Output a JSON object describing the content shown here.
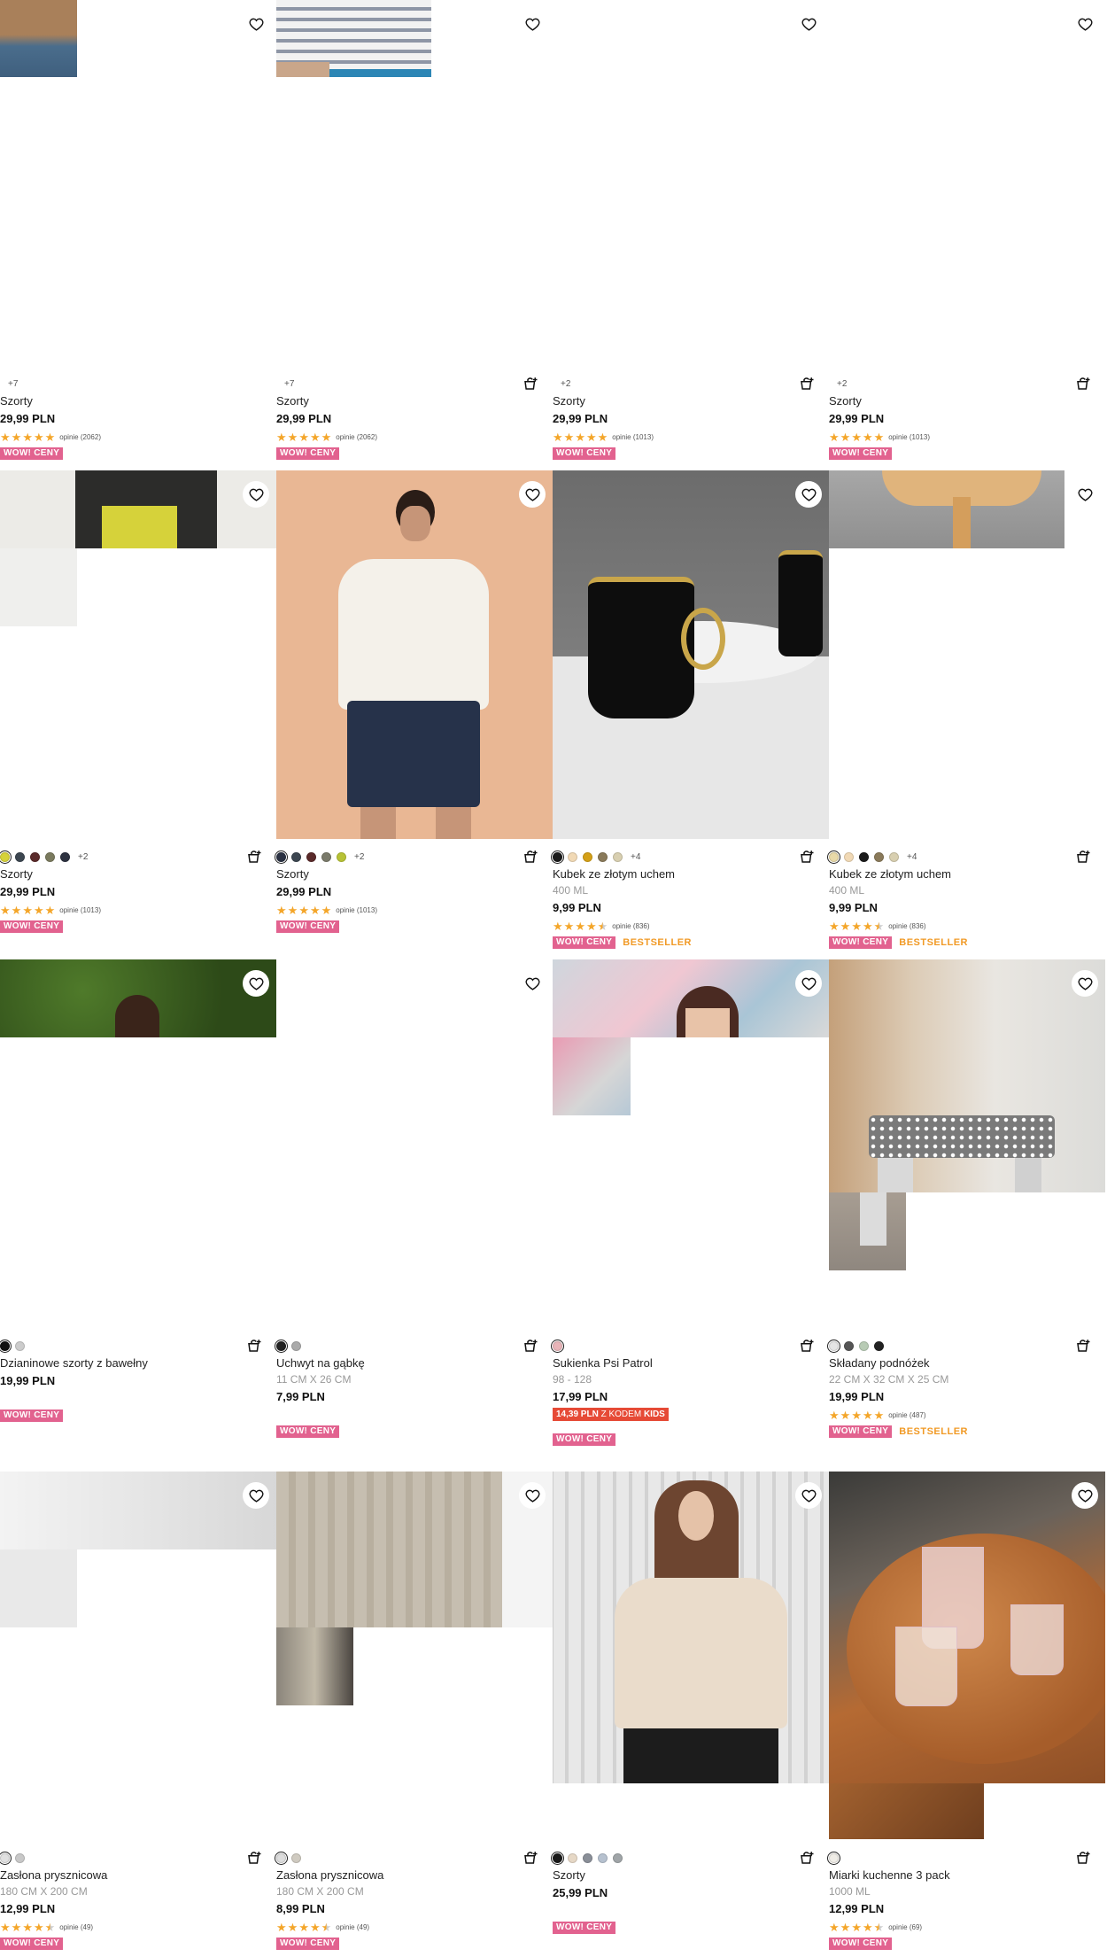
{
  "products": [
    {
      "swatches": [],
      "more": "+7",
      "name": "Szorty",
      "sub": "",
      "price": "29,99 PLN",
      "stars": 5,
      "reviews": "opinie (2062)",
      "badges": [
        "WOW! CENY"
      ],
      "cart": false
    },
    {
      "swatches": [],
      "more": "+7",
      "name": "Szorty",
      "sub": "",
      "price": "29,99 PLN",
      "stars": 5,
      "reviews": "opinie (2062)",
      "badges": [
        "WOW! CENY"
      ],
      "cart": true
    },
    {
      "swatches": [],
      "more": "+2",
      "name": "Szorty",
      "sub": "",
      "price": "29,99 PLN",
      "stars": 5,
      "reviews": "opinie (1013)",
      "badges": [
        "WOW! CENY"
      ],
      "cart": true
    },
    {
      "swatches": [],
      "more": "+2",
      "name": "Szorty",
      "sub": "",
      "price": "29,99 PLN",
      "stars": 5,
      "reviews": "opinie (1013)",
      "badges": [
        "WOW! CENY"
      ],
      "cart": true
    },
    {
      "swatches": [
        "#d6d23a",
        "#3c4650",
        "#5a2a2a",
        "#7a7a5e",
        "#2d3240"
      ],
      "more": "+2",
      "name": "Szorty",
      "sub": "",
      "price": "29,99 PLN",
      "stars": 5,
      "reviews": "opinie (1013)",
      "badges": [
        "WOW! CENY"
      ],
      "cart": true
    },
    {
      "swatches": [
        "#2a3142",
        "#3c4650",
        "#5a2a2a",
        "#7a7a6a",
        "#b7c236"
      ],
      "more": "+2",
      "name": "Szorty",
      "sub": "",
      "price": "29,99 PLN",
      "stars": 5,
      "reviews": "opinie (1013)",
      "badges": [
        "WOW! CENY"
      ],
      "cart": true
    },
    {
      "swatches": [
        "#1a1a1a",
        "#f1d9b5",
        "#d4a017",
        "#8a7a5a",
        "#d8cfb0"
      ],
      "more": "+4",
      "name": "Kubek ze złotym uchem",
      "sub": "400 ML",
      "price": "9,99 PLN",
      "stars": 4.5,
      "reviews": "opinie (836)",
      "badges": [
        "WOW! CENY",
        "BESTSELLER"
      ],
      "cart": true
    },
    {
      "swatches": [
        "#e8d9a8",
        "#f1d9b5",
        "#1a1a1a",
        "#8a7a5a",
        "#d8cfb0"
      ],
      "more": "+4",
      "name": "Kubek ze złotym uchem",
      "sub": "400 ML",
      "price": "9,99 PLN",
      "stars": 4.5,
      "reviews": "opinie (836)",
      "badges": [
        "WOW! CENY",
        "BESTSELLER"
      ],
      "cart": true
    },
    {
      "swatches": [
        "#111111",
        "#cccccc"
      ],
      "more": "",
      "name": "Dzianinowe szorty z bawełny",
      "sub": "",
      "price": "19,99 PLN",
      "stars": 0,
      "reviews": "",
      "badges": [
        "WOW! CENY"
      ],
      "cart": true
    },
    {
      "swatches": [
        "#222222",
        "#aaaaaa"
      ],
      "more": "",
      "name": "Uchwyt na gąbkę",
      "sub": "11 CM X 26 CM",
      "price": "7,99 PLN",
      "stars": 0,
      "reviews": "",
      "badges": [
        "WOW! CENY"
      ],
      "cart": true
    },
    {
      "swatches": [
        "#e8b4b8"
      ],
      "more": "",
      "name": "Sukienka Psi Patrol",
      "sub": "98 - 128",
      "price": "17,99 PLN",
      "stars": 0,
      "reviews": "",
      "kids": {
        "price": "14,39 PLN",
        "text": "Z KODEM",
        "code": "KIDS"
      },
      "badges": [
        "WOW! CENY"
      ],
      "cart": true
    },
    {
      "swatches": [
        "#e5e5e5",
        "#555555",
        "#b8cbb5",
        "#222222"
      ],
      "more": "",
      "name": "Składany podnóżek",
      "sub": "22 CM X 32 CM X 25 CM",
      "price": "19,99 PLN",
      "stars": 5,
      "reviews": "opinie (487)",
      "badges": [
        "WOW! CENY",
        "BESTSELLER"
      ],
      "cart": true
    },
    {
      "swatches": [
        "#e0e0e0",
        "#c8c8c8"
      ],
      "more": "",
      "name": "Zasłona prysznicowa",
      "sub": "180 CM X 200 CM",
      "price": "12,99 PLN",
      "stars": 4.5,
      "reviews": "opinie (49)",
      "badges": [
        "WOW! CENY"
      ],
      "cart": true
    },
    {
      "swatches": [
        "#dddddd",
        "#cfcac0"
      ],
      "more": "",
      "name": "Zasłona prysznicowa",
      "sub": "180 CM X 200 CM",
      "price": "8,99 PLN",
      "stars": 4.5,
      "reviews": "opinie (49)",
      "badges": [
        "WOW! CENY"
      ],
      "cart": true
    },
    {
      "swatches": [
        "#1a1a1a",
        "#e6d8c6",
        "#8a8f98",
        "#b6c1cf",
        "#a0a5a8"
      ],
      "more": "",
      "name": "Szorty",
      "sub": "",
      "price": "25,99 PLN",
      "stars": 0,
      "reviews": "",
      "badges": [
        "WOW! CENY"
      ],
      "cart": true
    },
    {
      "swatches": [
        "#efece6"
      ],
      "more": "",
      "name": "Miarki kuchenne 3 pack",
      "sub": "1000 ML",
      "price": "12,99 PLN",
      "stars": 4.5,
      "reviews": "opinie (69)",
      "badges": [
        "WOW! CENY"
      ],
      "cart": true
    }
  ]
}
